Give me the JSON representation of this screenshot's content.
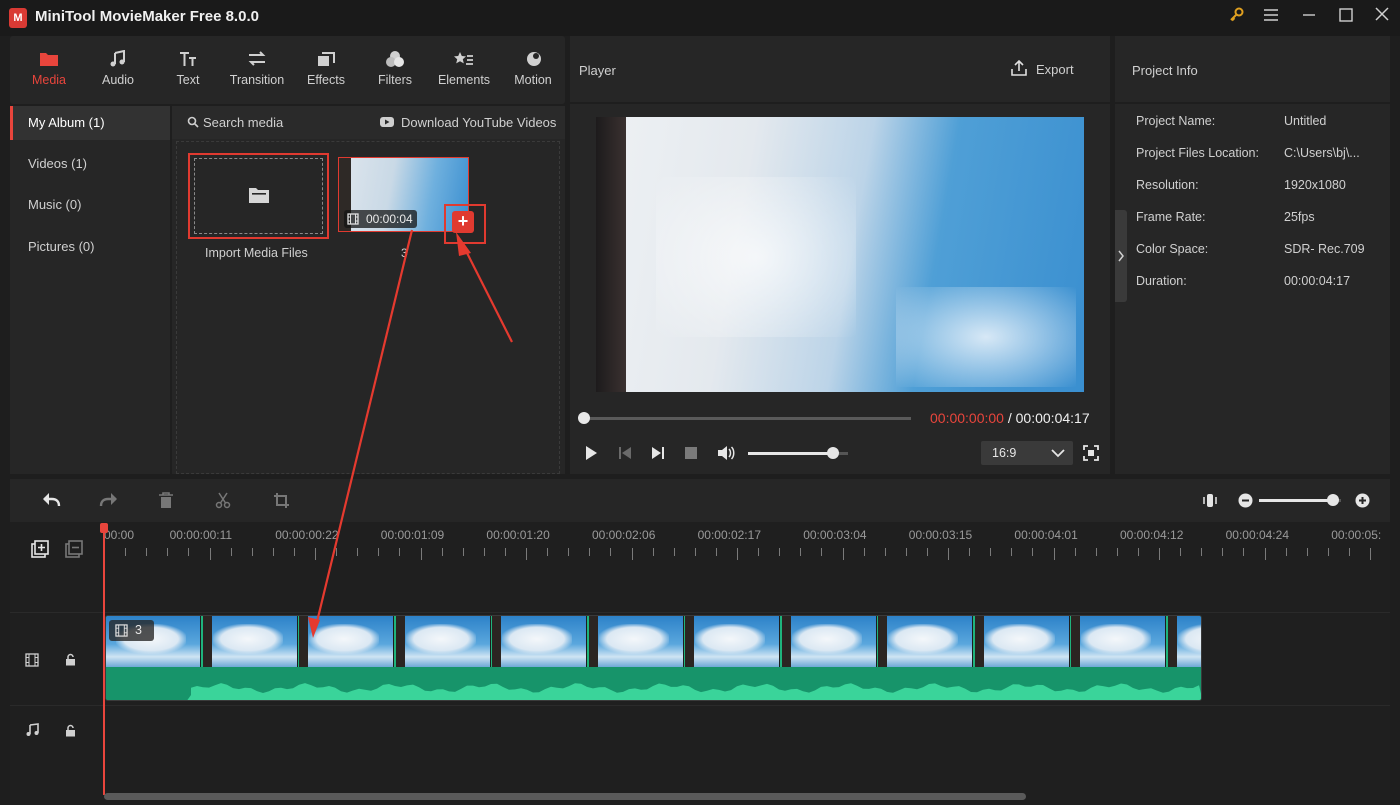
{
  "window": {
    "title": "MiniTool MovieMaker Free 8.0.0",
    "logo_text": "M"
  },
  "toolbar": {
    "tools": [
      {
        "label": "Media",
        "icon": "folder-icon"
      },
      {
        "label": "Audio",
        "icon": "music-note-icon"
      },
      {
        "label": "Text",
        "icon": "text-icon"
      },
      {
        "label": "Transition",
        "icon": "transition-icon"
      },
      {
        "label": "Effects",
        "icon": "effects-icon"
      },
      {
        "label": "Filters",
        "icon": "filters-icon"
      },
      {
        "label": "Elements",
        "icon": "elements-icon"
      },
      {
        "label": "Motion",
        "icon": "motion-icon"
      }
    ],
    "active": "Media",
    "accent": "#e8453c"
  },
  "sidebar": {
    "items": [
      {
        "label": "My Album (1)"
      },
      {
        "label": "Videos (1)"
      },
      {
        "label": "Music (0)"
      },
      {
        "label": "Pictures (0)"
      }
    ]
  },
  "media": {
    "search_label": "Search media",
    "download_label": "Download YouTube Videos",
    "import_label": "Import Media Files",
    "clip": {
      "duration": "00:00:04",
      "name": "3"
    }
  },
  "player": {
    "title": "Player",
    "export_label": "Export",
    "current_time": "00:00:00:00",
    "separator": "/",
    "total_time": "00:00:04:17",
    "aspect_ratio": "16:9",
    "progress": 0,
    "volume": 0.85
  },
  "project_info": {
    "title": "Project Info",
    "rows": [
      {
        "key": "Project Name:",
        "value": "Untitled"
      },
      {
        "key": "Project Files Location:",
        "value": "C:\\Users\\bj\\..."
      },
      {
        "key": "Resolution:",
        "value": "1920x1080"
      },
      {
        "key": "Frame Rate:",
        "value": "25fps"
      },
      {
        "key": "Color Space:",
        "value": "SDR- Rec.709"
      },
      {
        "key": "Duration:",
        "value": "00:00:04:17"
      }
    ]
  },
  "timeline": {
    "ticks": [
      "00:00",
      "00:00:00:11",
      "00:00:00:22",
      "00:00:01:09",
      "00:00:01:20",
      "00:00:02:06",
      "00:00:02:17",
      "00:00:03:04",
      "00:00:03:15",
      "00:00:04:01",
      "00:00:04:12",
      "00:00:04:24",
      "00:00:05:"
    ],
    "clip_label": "3",
    "zoom": 0.9
  }
}
